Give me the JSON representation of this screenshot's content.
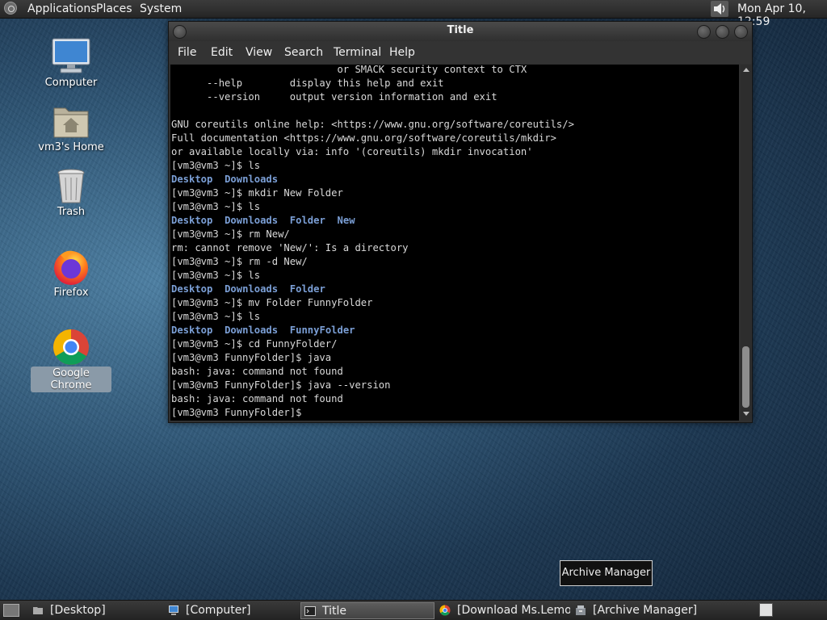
{
  "top_panel": {
    "menus": [
      "Applications",
      "Places",
      "System"
    ],
    "clock": "Mon Apr 10, 12:59"
  },
  "desktop_icons": [
    {
      "label": "Computer",
      "icon": "computer-icon"
    },
    {
      "label": "vm3's Home",
      "icon": "home-folder-icon"
    },
    {
      "label": "Trash",
      "icon": "trash-icon"
    },
    {
      "label": "Firefox",
      "icon": "firefox-icon"
    },
    {
      "label": "Google Chrome",
      "icon": "chrome-icon"
    }
  ],
  "window": {
    "title": "Title",
    "menus": [
      "File",
      "Edit",
      "View",
      "Search",
      "Terminal",
      "Help"
    ]
  },
  "terminal": {
    "lines": [
      "                            or SMACK security context to CTX",
      "      --help        display this help and exit",
      "      --version     output version information and exit",
      "",
      "GNU coreutils online help: <https://www.gnu.org/software/coreutils/>",
      "Full documentation <https://www.gnu.org/software/coreutils/mkdir>",
      "or available locally via: info '(coreutils) mkdir invocation'",
      "[vm3@vm3 ~]$ ls",
      "",
      "[vm3@vm3 ~]$ mkdir New Folder",
      "[vm3@vm3 ~]$ ls",
      "",
      "[vm3@vm3 ~]$ rm New/",
      "rm: cannot remove 'New/': Is a directory",
      "[vm3@vm3 ~]$ rm -d New/",
      "[vm3@vm3 ~]$ ls",
      "",
      "[vm3@vm3 ~]$ mv Folder FunnyFolder",
      "[vm3@vm3 ~]$ ls",
      "",
      "[vm3@vm3 ~]$ cd FunnyFolder/",
      "[vm3@vm3 FunnyFolder]$ java",
      "bash: java: command not found",
      "[vm3@vm3 FunnyFolder]$ java --version",
      "bash: java: command not found",
      "[vm3@vm3 FunnyFolder]$"
    ],
    "ls1": [
      "Desktop",
      "Downloads"
    ],
    "ls2": [
      "Desktop",
      "Downloads",
      "Folder",
      "New"
    ],
    "ls3": [
      "Desktop",
      "Downloads",
      "Folder"
    ],
    "ls4": [
      "Desktop",
      "Downloads",
      "FunnyFolder"
    ],
    "dir_color": "#7b9fd6"
  },
  "tooltip": "Archive Manager",
  "taskbar": [
    {
      "label": "[Desktop]",
      "icon": "desktop-icon",
      "active": false
    },
    {
      "label": "[Computer]",
      "icon": "computer-icon",
      "active": false
    },
    {
      "label": "Title",
      "icon": "terminal-icon",
      "active": true
    },
    {
      "label": "[Download Ms.Lemo...",
      "icon": "chrome-icon",
      "active": false
    },
    {
      "label": "[Archive Manager]",
      "icon": "archive-icon",
      "active": false
    }
  ]
}
